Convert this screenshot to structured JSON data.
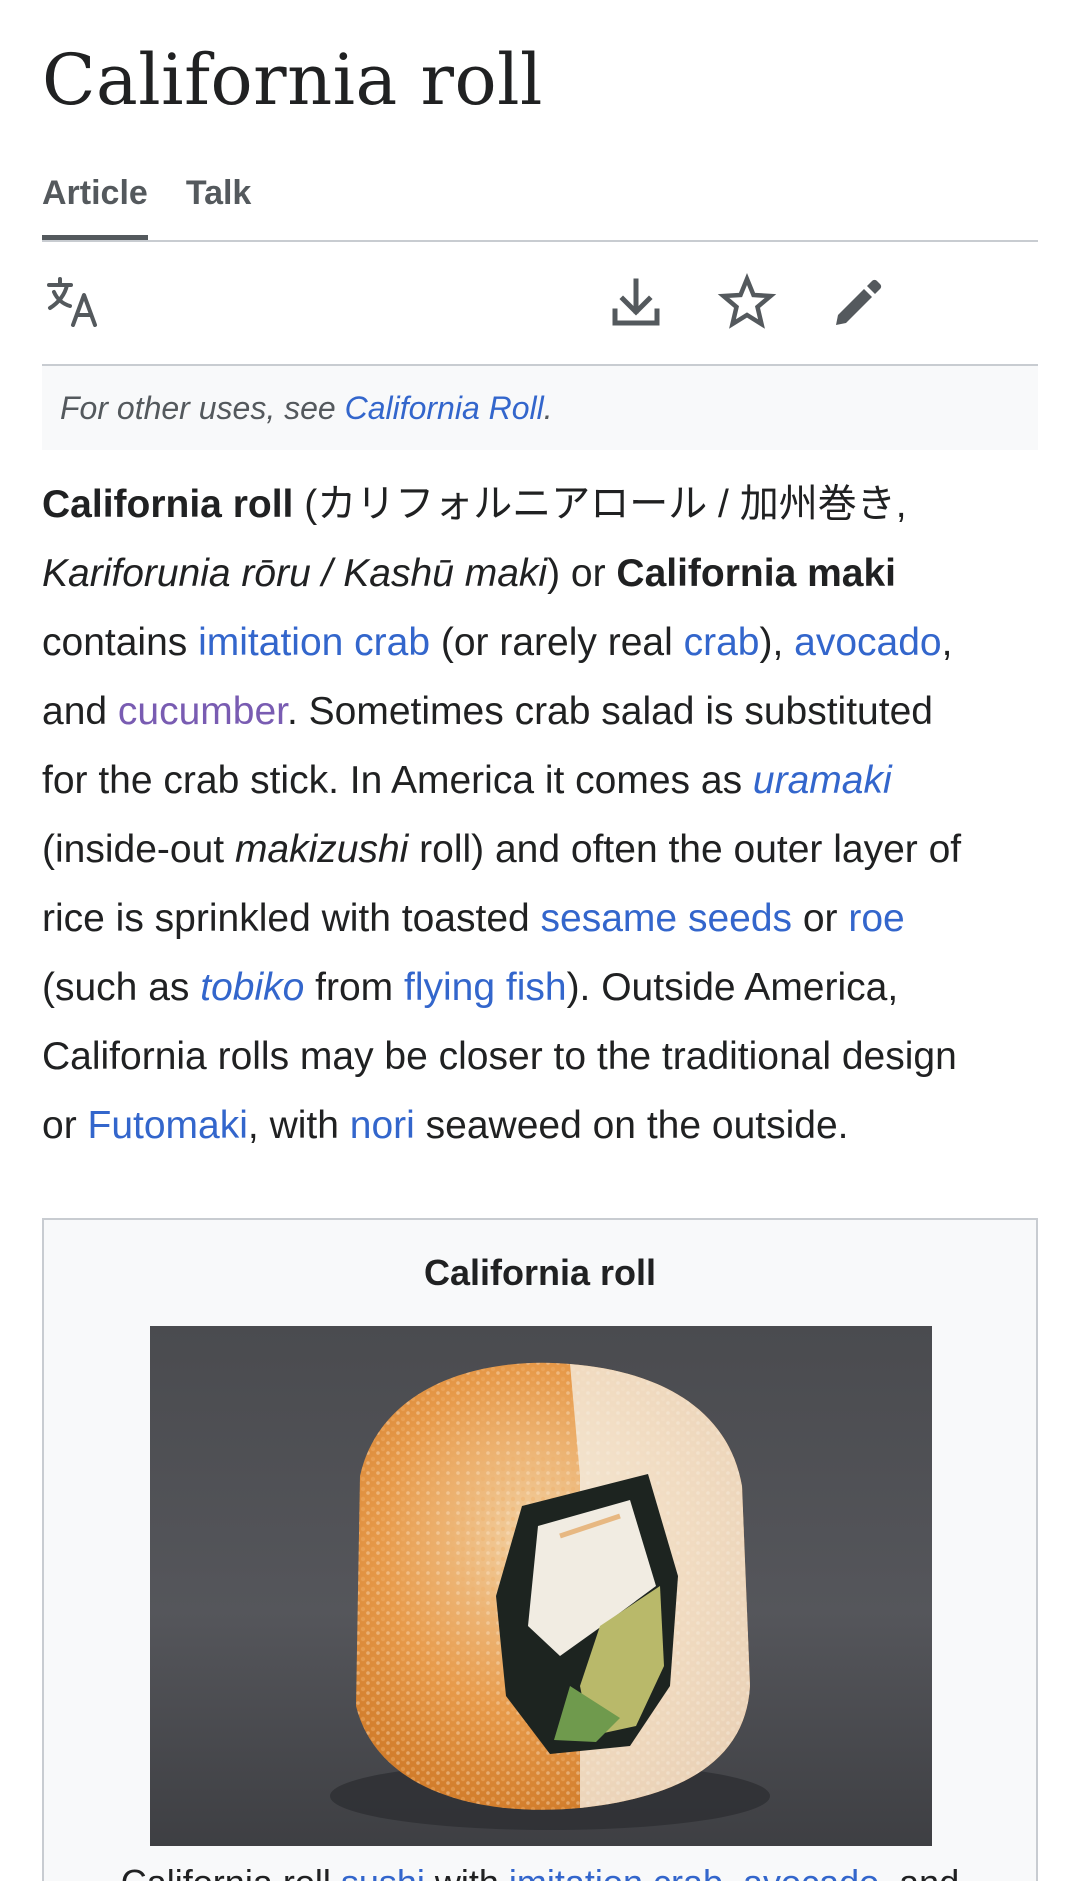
{
  "page": {
    "title": "California roll"
  },
  "tabs": [
    {
      "label": "Article",
      "active": true
    },
    {
      "label": "Talk",
      "active": false
    }
  ],
  "toolbar": {
    "icons": [
      "language-icon",
      "download-icon",
      "star-icon",
      "edit-icon"
    ]
  },
  "hatnote": {
    "prefix": "For other uses, see ",
    "link": "California Roll",
    "suffix": "."
  },
  "lead": {
    "line1_bold": "California roll",
    "line1_text": " (カリフォルニアロール / 加州巻き,",
    "line2_italic": "Kariforunia rōru / Kashū maki",
    "line2_text": ") or ",
    "line2_bold": "California maki",
    "line3_text_a": "contains ",
    "link_imitation_crab": "imitation crab",
    "line3_text_b": " (or rarely real ",
    "link_crab": "crab",
    "line3_text_c": "), ",
    "link_avocado": "avocado",
    "line3_text_d": ",",
    "line4_text_a": "and ",
    "link_cucumber": "cucumber",
    "line4_text_b": ". Sometimes crab salad is substituted",
    "line5_text_a": "for the crab stick. In America it comes as ",
    "link_uramaki": "uramaki",
    "line6_text_a": "(inside-out ",
    "line6_italic": "makizushi",
    "line6_text_b": " roll) and often the outer layer of",
    "line7_text_a": "rice is sprinkled with toasted ",
    "link_sesame_seeds": "sesame seeds",
    "line7_text_b": " or ",
    "link_roe": "roe",
    "line8_text_a": "(such as ",
    "link_tobiko": "tobiko",
    "line8_text_b": " from ",
    "link_flying_fish": "flying fish",
    "line8_text_c": "). Outside America,",
    "line9_text": "California rolls may be closer to the traditional design",
    "line10_text_a": "or ",
    "link_futomaki": "Futomaki",
    "line10_text_b": ", with ",
    "link_nori": "nori",
    "line10_text_c": " seaweed on the outside."
  },
  "infobox": {
    "title": "California roll",
    "caption_prefix": "California roll ",
    "caption_link_sushi": "sushi",
    "caption_text_with": " with ",
    "caption_link_imitation_crab": "imitation crab",
    "caption_sep": ", ",
    "caption_link_avocado": "avocado",
    "caption_suffix": ", and"
  },
  "colors": {
    "link": "#3366cc",
    "visited_link": "#795cb2",
    "text": "#202122",
    "muted": "#54595d",
    "border": "#c8ccd1",
    "panel": "#f8f9fa"
  }
}
